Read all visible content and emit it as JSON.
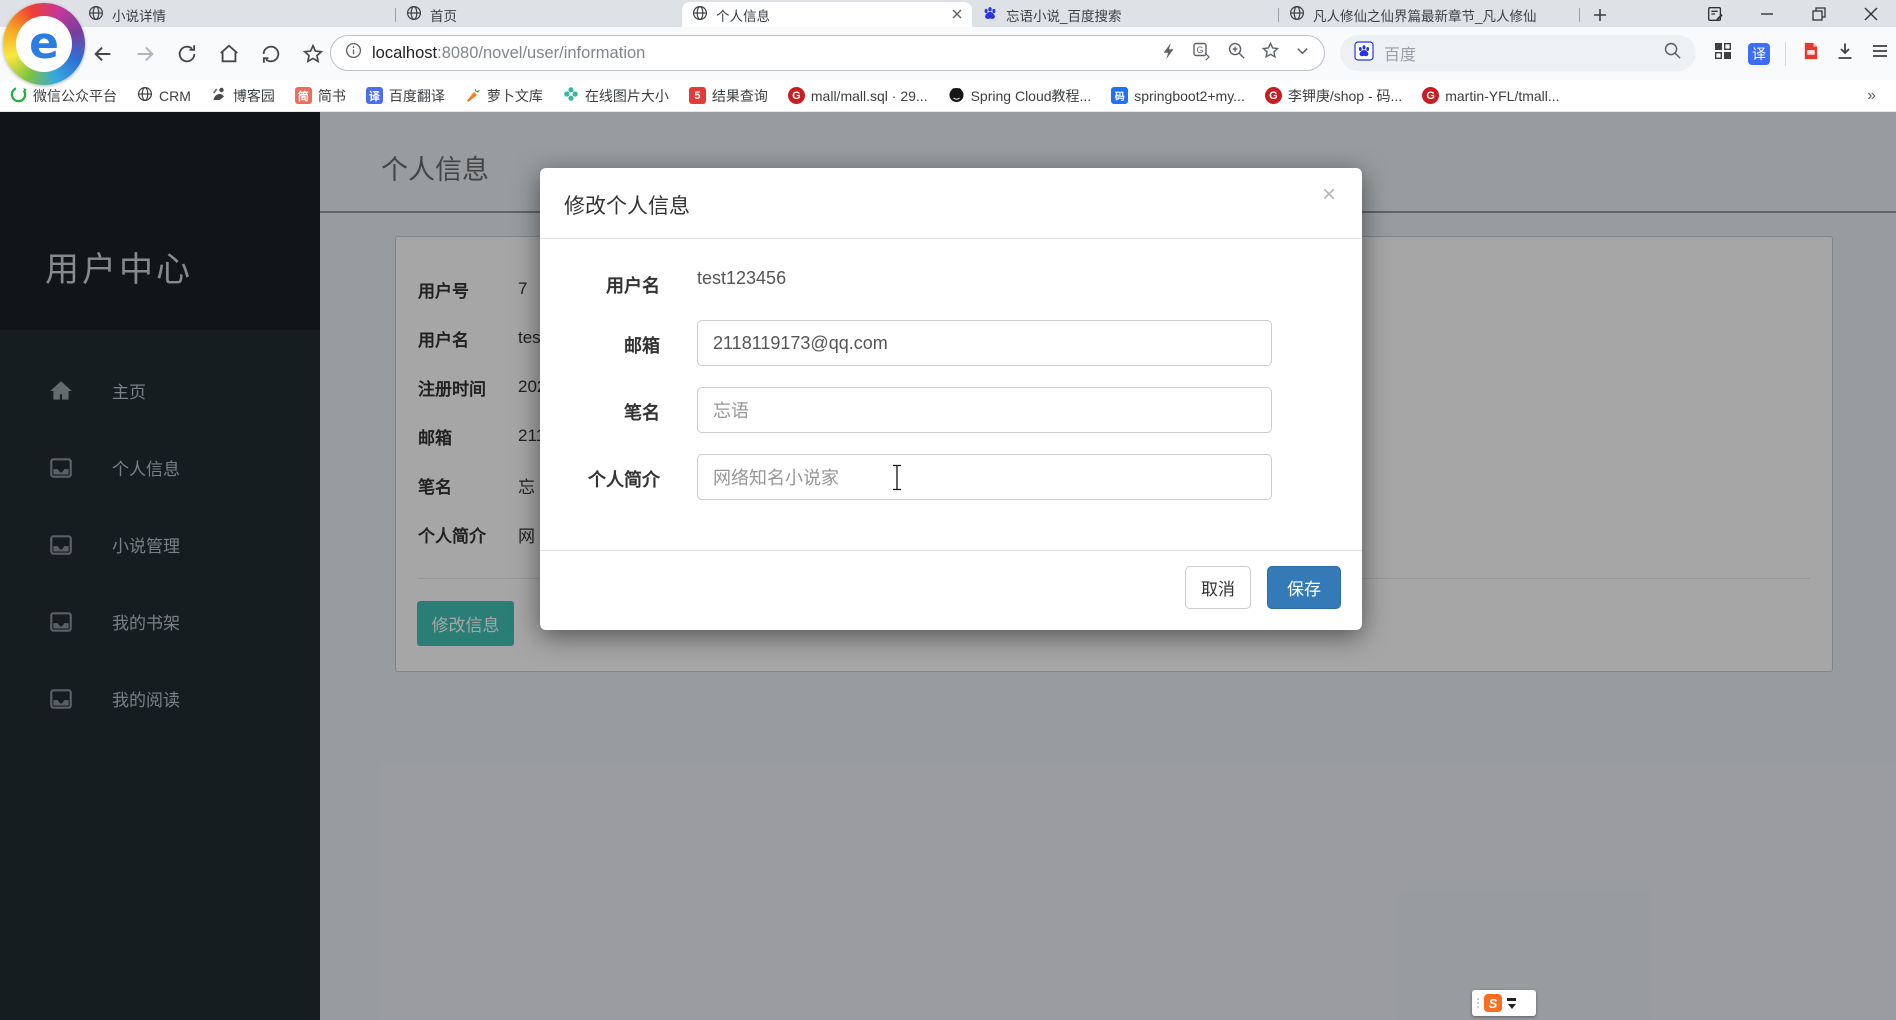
{
  "browser": {
    "tabs": [
      {
        "title": "小说详情"
      },
      {
        "title": "首页"
      },
      {
        "title": "个人信息",
        "active": true
      },
      {
        "title": "忘语小说_百度搜索"
      },
      {
        "title": "凡人修仙之仙界篇最新章节_凡人修仙"
      }
    ],
    "url": {
      "host": "localhost",
      "path": ":8080/novel/user/information"
    },
    "search": {
      "engine_label": "百度"
    },
    "bookmarks": [
      "微信公众平台",
      "CRM",
      "博客园",
      "简书",
      "百度翻译",
      "萝卜文库",
      "在线图片大小",
      "结果查询",
      "mall/mall.sql · 29...",
      "Spring Cloud教程...",
      "springboot2+my...",
      "李钾庚/shop - 码...",
      "martin-YFL/tmall..."
    ],
    "bookmarks_overflow": "»",
    "bookmark_badges": {
      "jianshu": "简",
      "fanyi": "译",
      "five": "5",
      "gitee": "G",
      "code": "码"
    }
  },
  "sidebar": {
    "title": "用户中心",
    "items": [
      "主页",
      "个人信息",
      "小说管理",
      "我的书架",
      "我的阅读"
    ]
  },
  "content": {
    "page_title": "个人信息",
    "panel": {
      "fields": [
        {
          "label": "用户号",
          "value": "7"
        },
        {
          "label": "用户名",
          "value": "tes"
        },
        {
          "label": "注册时间",
          "value": "202"
        },
        {
          "label": "邮箱",
          "value": "211"
        },
        {
          "label": "笔名",
          "value": "忘"
        },
        {
          "label": "个人简介",
          "value": "网"
        }
      ],
      "edit_button": "修改信息"
    }
  },
  "modal": {
    "title": "修改个人信息",
    "close": "×",
    "username_label": "用户名",
    "username_value": "test123456",
    "email_label": "邮箱",
    "email_value": "2118119173@qq.com",
    "penname_label": "笔名",
    "penname_value": "忘语",
    "bio_label": "个人简介",
    "bio_value": "网络知名小说家",
    "cancel_label": "取消",
    "save_label": "保存"
  },
  "ime": {
    "badge": "S"
  },
  "colors": {
    "save_blue": "#337ab7",
    "teal_button": "#42c2b6",
    "sidebar_bg": "#222d32",
    "sidebar_logo_bg": "#1a2226",
    "content_bg": "#ecf0f5",
    "backdrop": "rgba(0,0,0,0.35)"
  }
}
